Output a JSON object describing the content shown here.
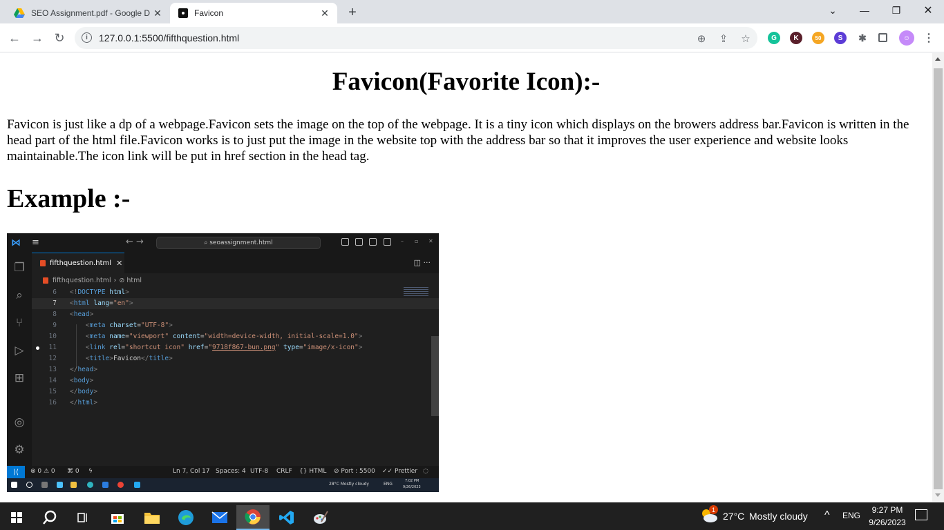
{
  "browser": {
    "tabs": [
      {
        "title": "SEO Assignment.pdf - Google D",
        "icon": "google-drive-icon",
        "active": false
      },
      {
        "title": "Favicon",
        "icon": "custom-favicon-icon",
        "active": true
      }
    ],
    "url": "127.0.0.1:5500/fifthquestion.html",
    "extensions": [
      {
        "name": "grammarly-icon",
        "color": "#15c39a",
        "glyph": "G"
      },
      {
        "name": "k-extension-icon",
        "color": "#5a1f2b",
        "glyph": "K"
      },
      {
        "name": "50-extension-icon",
        "color": "#f5a623",
        "glyph": "50"
      },
      {
        "name": "s-extension-icon",
        "color": "#5c3cd6",
        "glyph": "S"
      },
      {
        "name": "puzzle-extensions-icon",
        "color": "#5f6368",
        "glyph": "✱"
      }
    ]
  },
  "page": {
    "heading": "Favicon(Favorite Icon):-",
    "paragraph": "Favicon is just like a dp of a webpage.Favicon sets the image on the top of the webpage. It is a tiny icon which displays on the browers address bar.Favicon is written in the head part of the html file.Favicon works is to just put the image in the website top with the address bar so that it improves the user experience and website looks maintainable.The icon link will be put in href section in the head tag.",
    "subheading": "Example :-"
  },
  "vscode": {
    "search": "seoassignment.html",
    "tab": "fifthquestion.html",
    "breadcrumb": [
      "fifthquestion.html",
      "html"
    ],
    "lines": [
      {
        "n": "6",
        "html": "<span class='t'>&lt;!</span><span class='k'>DOCTYPE</span> <span class='a'>html</span><span class='t'>&gt;</span>"
      },
      {
        "n": "7",
        "html": "<span class='t'>&lt;</span><span class='k'>html</span> <span class='a'>lang</span>=<span class='s'>\"en\"</span><span class='t'>&gt;</span>"
      },
      {
        "n": "8",
        "html": "<span class='t'>&lt;</span><span class='k'>head</span><span class='t'>&gt;</span>"
      },
      {
        "n": "9",
        "html": "    <span class='t'>&lt;</span><span class='k'>meta</span> <span class='a'>charset</span>=<span class='s'>\"UTF-8\"</span><span class='t'>&gt;</span>"
      },
      {
        "n": "10",
        "html": "    <span class='t'>&lt;</span><span class='k'>meta</span> <span class='a'>name</span>=<span class='s'>\"viewport\"</span> <span class='a'>content</span>=<span class='s'>\"width=device-width, initial-scale=1.0\"</span><span class='t'>&gt;</span>"
      },
      {
        "n": "11",
        "html": "    <span class='t'>&lt;</span><span class='k'>link</span> <span class='a'>rel</span>=<span class='s'>\"shortcut icon\"</span> <span class='a'>href</span>=<span class='s'>\"<span class='u'>9718f867-bun.png</span>\"</span> <span class='a'>type</span>=<span class='s'>\"image/x-icon\"</span><span class='t'>&gt;</span>"
      },
      {
        "n": "12",
        "html": "    <span class='t'>&lt;</span><span class='k'>title</span><span class='t'>&gt;</span>Favicon<span class='t'>&lt;/</span><span class='k'>title</span><span class='t'>&gt;</span>"
      },
      {
        "n": "13",
        "html": "<span class='t'>&lt;/</span><span class='k'>head</span><span class='t'>&gt;</span>"
      },
      {
        "n": "14",
        "html": "<span class='t'>&lt;</span><span class='k'>body</span><span class='t'>&gt;</span>"
      },
      {
        "n": "15",
        "html": "<span class='t'>&lt;/</span><span class='k'>body</span><span class='t'>&gt;</span>"
      },
      {
        "n": "16",
        "html": "<span class='t'>&lt;/</span><span class='k'>html</span><span class='t'>&gt;</span>"
      }
    ],
    "status": {
      "problems": "⊗ 0 ⚠ 0",
      "ports": "⌘ 0",
      "position": "Ln 7, Col 17",
      "spaces": "Spaces: 4",
      "encoding": "UTF-8",
      "eol": "CRLF",
      "language": "{} HTML",
      "port": "⊘ Port : 5500",
      "prettier": "✓✓ Prettier"
    },
    "taskbar": {
      "weather": "28°C  Mostly cloudy",
      "lang": "ENG",
      "time": "7:02 PM",
      "date": "9/26/2023"
    }
  },
  "taskbar": {
    "weather_temp": "27°C",
    "weather_desc": "Mostly cloudy",
    "weather_badge": "1",
    "lang": "ENG",
    "time": "9:27 PM",
    "date": "9/26/2023"
  }
}
